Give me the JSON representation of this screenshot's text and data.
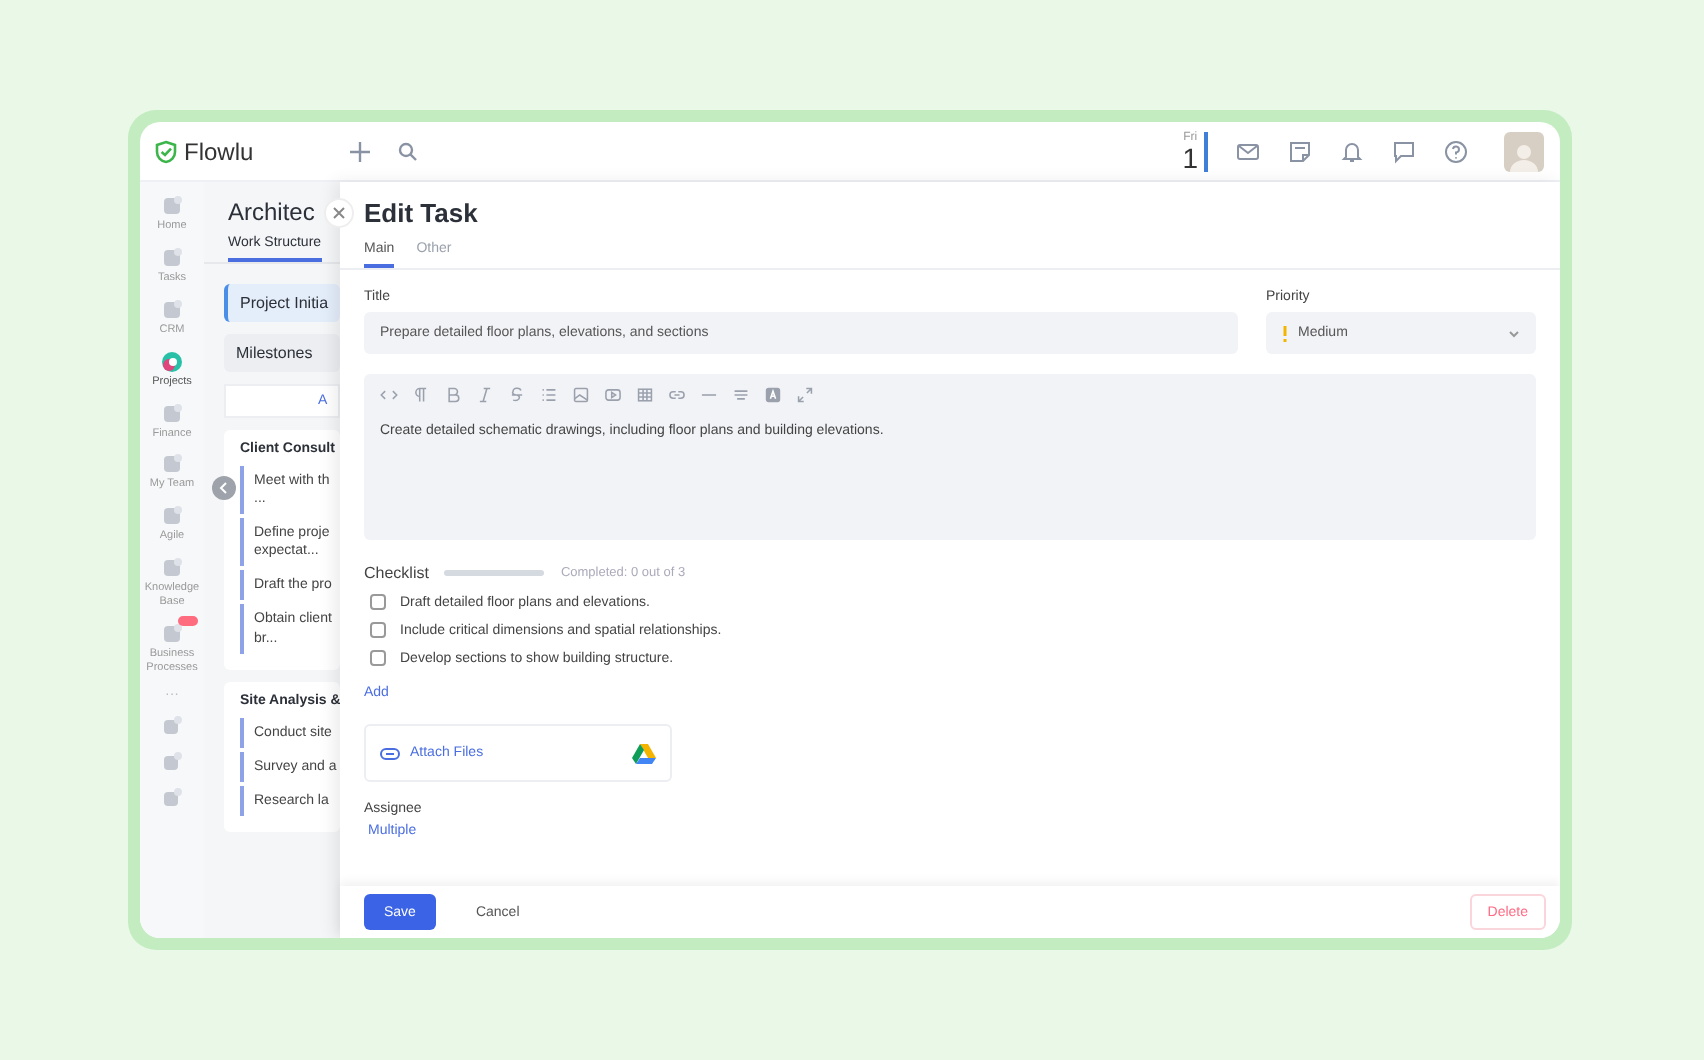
{
  "top_bar": {
    "logo": "Flowlu",
    "date": {
      "weekday": "Fri",
      "day": "1"
    }
  },
  "nav": {
    "items": [
      {
        "label": "Home",
        "selected": false,
        "badge": false
      },
      {
        "label": "Tasks",
        "selected": false,
        "badge": false
      },
      {
        "label": "CRM",
        "selected": false,
        "badge": false
      },
      {
        "label": "Projects",
        "selected": true,
        "badge": false
      },
      {
        "label": "Finance",
        "selected": false,
        "badge": false
      },
      {
        "label": "My Team",
        "selected": false,
        "badge": false
      },
      {
        "label": "Agile",
        "selected": false,
        "badge": false
      },
      {
        "label": "Knowledge Base",
        "selected": false,
        "badge": false
      },
      {
        "label": "Business Processes",
        "selected": false,
        "badge": true
      }
    ],
    "more": "···"
  },
  "project": {
    "title": "Architec",
    "tabs": [
      {
        "label": "Work Structure",
        "selected": true
      }
    ],
    "stages": [
      {
        "label": "Project Initia",
        "selected": true
      },
      {
        "label": "Milestones",
        "selected": false
      }
    ],
    "add_link": "A",
    "groups": [
      {
        "title": "Client Consult",
        "tasks": [
          "Meet with th ...",
          "Define proje expectat...",
          "Draft the pro",
          "Obtain client br..."
        ]
      },
      {
        "title": "Site Analysis &",
        "tasks": [
          "Conduct site",
          "Survey and a",
          "Research la"
        ]
      }
    ]
  },
  "edit_task": {
    "title": "Edit Task",
    "tabs": [
      {
        "label": "Main",
        "selected": true
      },
      {
        "label": "Other",
        "selected": false
      }
    ],
    "title_field": {
      "label": "Title",
      "value": "Prepare detailed floor plans, elevations, and sections"
    },
    "priority": {
      "label": "Priority",
      "value": "Medium"
    },
    "description": "Create detailed schematic drawings, including floor plans and building elevations.",
    "checklist": {
      "label": "Checklist",
      "level": 0,
      "summary": "Completed: 0 out of 3",
      "items": [
        {
          "text": "Draft detailed floor plans and elevations.",
          "checked": false
        },
        {
          "text": "Include critical dimensions and spatial relationships.",
          "checked": false
        },
        {
          "text": "Develop sections to show building structure.",
          "checked": false
        }
      ],
      "add": "Add"
    },
    "attach": "Attach Files",
    "assignee": {
      "label": "Assignee",
      "value": "Multiple"
    },
    "footer": {
      "save": "Save",
      "cancel": "Cancel",
      "delete": "Delete"
    }
  }
}
